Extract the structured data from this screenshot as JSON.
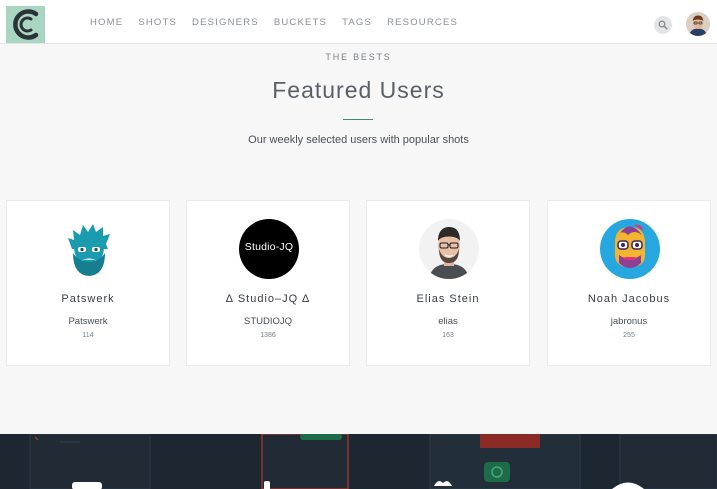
{
  "header": {
    "logo_icon": "c-logo-icon",
    "nav": [
      "HOME",
      "SHOTS",
      "DESIGNERS",
      "BUCKETS",
      "TAGS",
      "RESOURCES"
    ],
    "search_icon": "search-icon",
    "avatar_icon": "user-avatar"
  },
  "section": {
    "eyebrow": "THE BESTS",
    "title": "Featured Users",
    "subtitle": "Our weekly selected users with popular shots"
  },
  "users": [
    {
      "name": "Patswerk",
      "username": "Patswerk",
      "count": "114",
      "avatar": "bearded-head-avatar"
    },
    {
      "name": "∆ Studio–JQ ∆",
      "username": "STUDIOJQ",
      "count": "1386",
      "avatar": "studio-jq-logo",
      "avatar_text": "Studio-JQ"
    },
    {
      "name": "Elias Stein",
      "username": "elias",
      "count": "163",
      "avatar": "portrait-photo-avatar"
    },
    {
      "name": "Noah Jacobus",
      "username": "jabronus",
      "count": "255",
      "avatar": "cartoon-face-avatar"
    }
  ],
  "colors": {
    "accent": "#3f8a73",
    "logo_bg": "#a9d6c2",
    "patswerk": "#1a9bb0",
    "noah_bg": "#27a7e0",
    "footer": "#1d2731"
  }
}
